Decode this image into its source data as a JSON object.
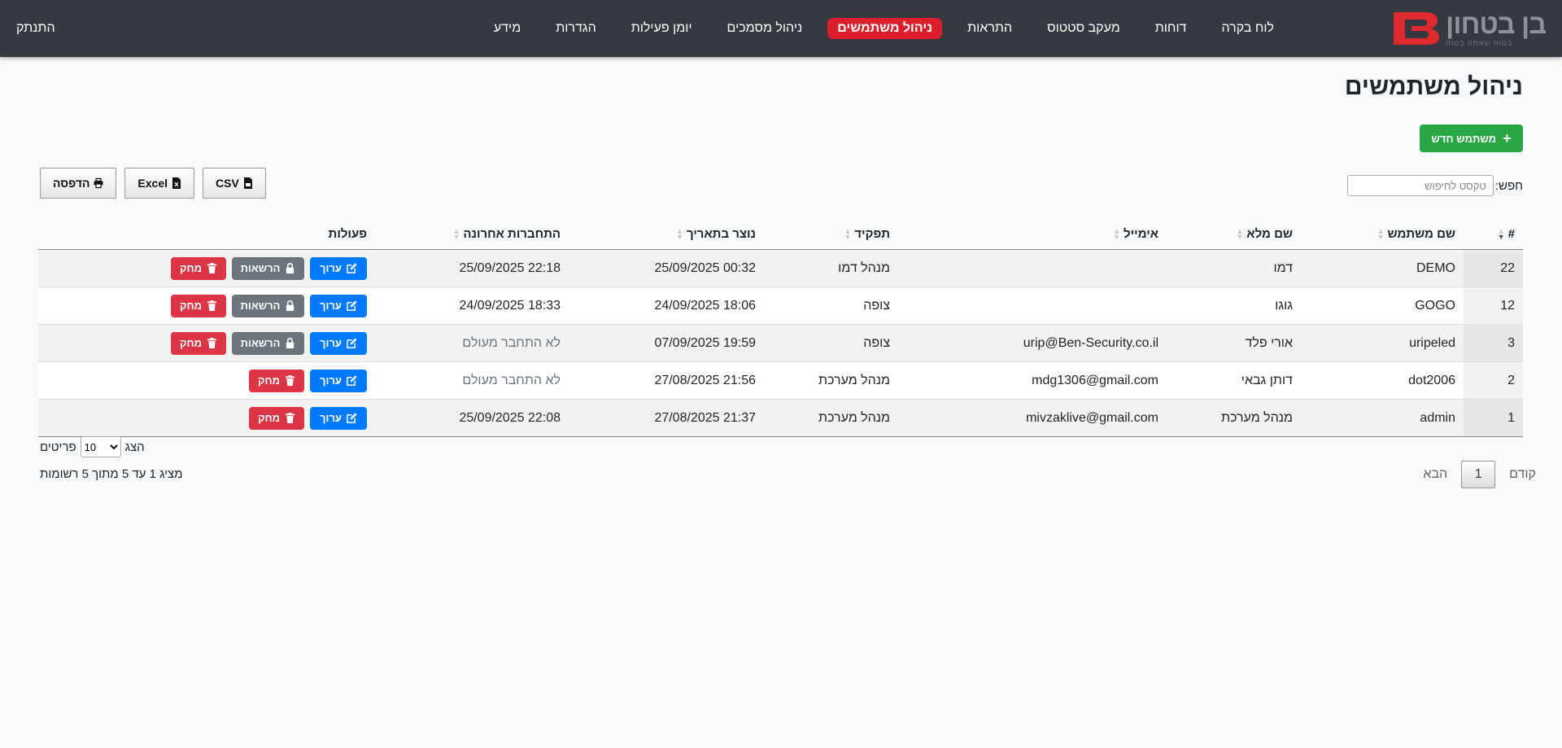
{
  "nav": {
    "brand_name": "בן בטחון",
    "brand_tagline": "בטוח שאתה בטוח",
    "links": [
      "לוח בקרה",
      "דוחות",
      "מעקב סטטוס",
      "התראות",
      "ניהול משתמשים",
      "ניהול מסמכים",
      "יומן פעילות",
      "הגדרות",
      "מידע"
    ],
    "active": "ניהול משתמשים",
    "logout": "התנתק",
    "colors": {
      "bar": "#343a40",
      "active": "#dc1f2c",
      "logo_red": "#e0292f"
    }
  },
  "page": {
    "title": "ניהול משתמשים",
    "new_user_button": "משתמש חדש"
  },
  "search": {
    "label": "חפש:",
    "placeholder": "טקסט לחיפוש"
  },
  "export": {
    "csv": "CSV",
    "excel": "Excel",
    "print": "הדפסה"
  },
  "table": {
    "headers": [
      "#",
      "שם משתמש",
      "שם מלא",
      "אימייל",
      "תפקיד",
      "נוצר בתאריך",
      "התחברות אחרונה",
      "פעולות"
    ],
    "actions": {
      "edit": "ערוך",
      "permissions": "הרשאות",
      "delete": "מחק"
    },
    "rows": [
      {
        "id": "22",
        "username": "DEMO",
        "full_name": "דמו",
        "email": "",
        "role": "מנהל דמו",
        "created": "25/09/2025 00:32",
        "last_login": "25/09/2025 22:18",
        "permissions": true
      },
      {
        "id": "12",
        "username": "GOGO",
        "full_name": "גוגו",
        "email": "",
        "role": "צופה",
        "created": "24/09/2025 18:06",
        "last_login": "24/09/2025 18:33",
        "permissions": true
      },
      {
        "id": "3",
        "username": "uripeled",
        "full_name": "אורי פלד",
        "email": "urip@Ben-Security.co.il",
        "role": "צופה",
        "created": "07/09/2025 19:59",
        "last_login": "לא התחבר מעולם",
        "permissions": true
      },
      {
        "id": "2",
        "username": "dot2006",
        "full_name": "דותן גבאי",
        "email": "mdg1306@gmail.com",
        "role": "מנהל מערכת",
        "created": "27/08/2025 21:56",
        "last_login": "לא התחבר מעולם",
        "permissions": false
      },
      {
        "id": "1",
        "username": "admin",
        "full_name": "מנהל מערכת",
        "email": "mivzaklive@gmail.com",
        "role": "מנהל מערכת",
        "created": "27/08/2025 21:37",
        "last_login": "25/09/2025 22:08",
        "permissions": false
      }
    ]
  },
  "length": {
    "show": "הצג",
    "value": "10",
    "options": [
      "10"
    ],
    "items": "פריטים"
  },
  "info": "מציג 1 עד 5 מתוך 5 רשומות",
  "paging": {
    "prev": "קודם",
    "current": "1",
    "next": "הבא"
  }
}
